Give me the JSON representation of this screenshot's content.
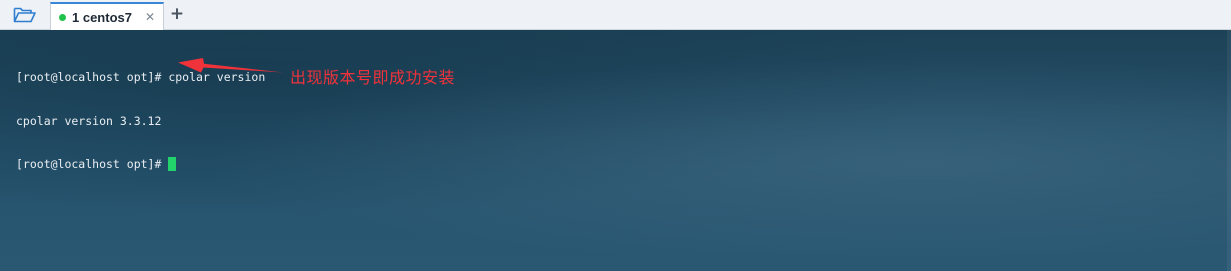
{
  "tabbar": {
    "folder_icon": "folder-open-icon",
    "tabs": [
      {
        "label": "1 centos7",
        "status_color": "#21c24a",
        "close_glyph": "✕"
      }
    ],
    "add_glyph": "+"
  },
  "terminal": {
    "lines": [
      "[root@localhost opt]# cpolar version",
      "cpolar version 3.3.12",
      "[root@localhost opt]#"
    ],
    "cursor_color": "#22d36b"
  },
  "annotation": {
    "text": "出现版本号即成功安装",
    "color": "#f0323a"
  }
}
